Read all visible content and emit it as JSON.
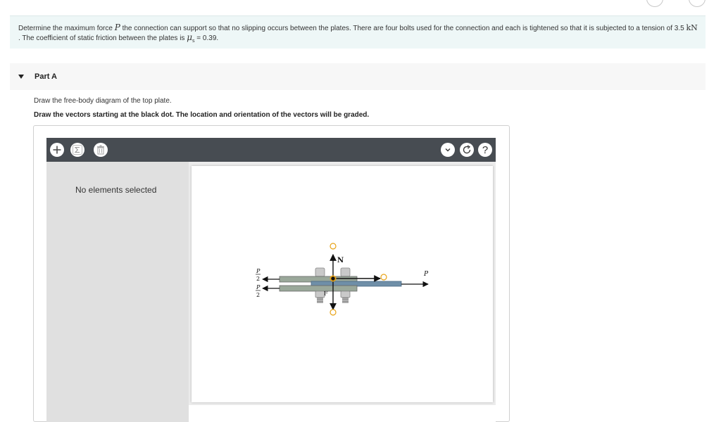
{
  "problem": {
    "text_1": "Determine the maximum force ",
    "var_P": "P",
    "text_2": " the connection can support so that no slipping occurs between the plates. There are four bolts used for the connection and each is tightened so that it is subjected to a tension of 3.5 ",
    "unit_kN": "kN",
    "text_3": " . The coefficient of static friction between the plates is ",
    "mu": "μ",
    "mu_sub": "s",
    "text_4": " = 0.39."
  },
  "part": {
    "title": "Part A"
  },
  "instructions": {
    "line1": "Draw the free-body diagram of the top plate.",
    "line2": "Draw the vectors starting at the black dot. The location and orientation of the vectors will be graded."
  },
  "toolbar": {
    "add_icon": "plus-icon",
    "sigma_icon": "sigma-icon",
    "trash_icon": "trash-icon",
    "dropdown_icon": "chevron-down-icon",
    "reset_icon": "reset-icon",
    "help_label": "?"
  },
  "panel": {
    "no_selection": "No elements selected"
  },
  "diagram": {
    "label_N": "N",
    "label_F": "F",
    "label_P_right": "P",
    "label_P_num_1": "P",
    "label_2_den_1": "2",
    "label_P_num_2": "P",
    "label_2_den_2": "2"
  },
  "colors": {
    "toolbar_bg": "#474c52",
    "problem_bg": "#eef7f7",
    "vector_handle": "#e8a317",
    "plate_top": "#9aa89a",
    "plate_bottom": "#6f8fa8"
  }
}
